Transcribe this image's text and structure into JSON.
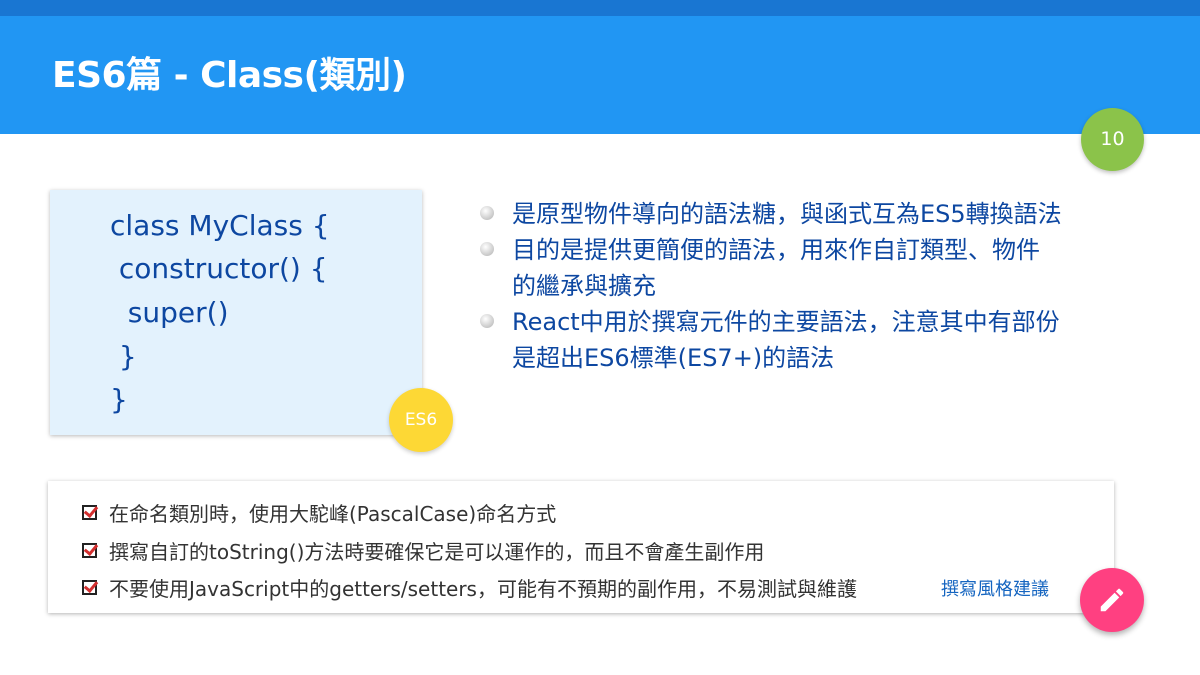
{
  "slide": {
    "title": "ES6篇 - Class(類別)",
    "page_number": "10",
    "colors": {
      "header": "#2196f3",
      "topbar": "#1976d2",
      "page_badge": "#8bc34a",
      "es6_badge": "#fdd835",
      "fab": "#ff4081",
      "text_blue": "#0d47a1",
      "code_bg": "#e3f2fd"
    }
  },
  "code": {
    "lines": [
      "class MyClass {",
      " constructor() {",
      "  super()",
      " }",
      "}"
    ],
    "badge": "ES6"
  },
  "bullets": [
    {
      "line1": "是原型物件導向的語法糖，與函式互為ES5轉換語法",
      "line2": ""
    },
    {
      "line1": "目的是提供更簡便的語法，用來作自訂類型、物件",
      "line2": "的繼承與擴充"
    },
    {
      "line1": "React中用於撰寫元件的主要語法，注意其中有部份",
      "line2": "是超出ES6標準(ES7+)的語法"
    }
  ],
  "notes": {
    "items": [
      "在命名類別時，使用大駝峰(PascalCase)命名方式",
      "撰寫自訂的toString()方法時要確保它是可以運作的，而且不會產生副作用",
      "不要使用JavaScript中的getters/setters，可能有不預期的副作用，不易測試與維護"
    ],
    "link_label": "撰寫風格建議",
    "check_icon": "checkbox-checked-icon"
  },
  "fab": {
    "icon": "pencil-icon"
  }
}
